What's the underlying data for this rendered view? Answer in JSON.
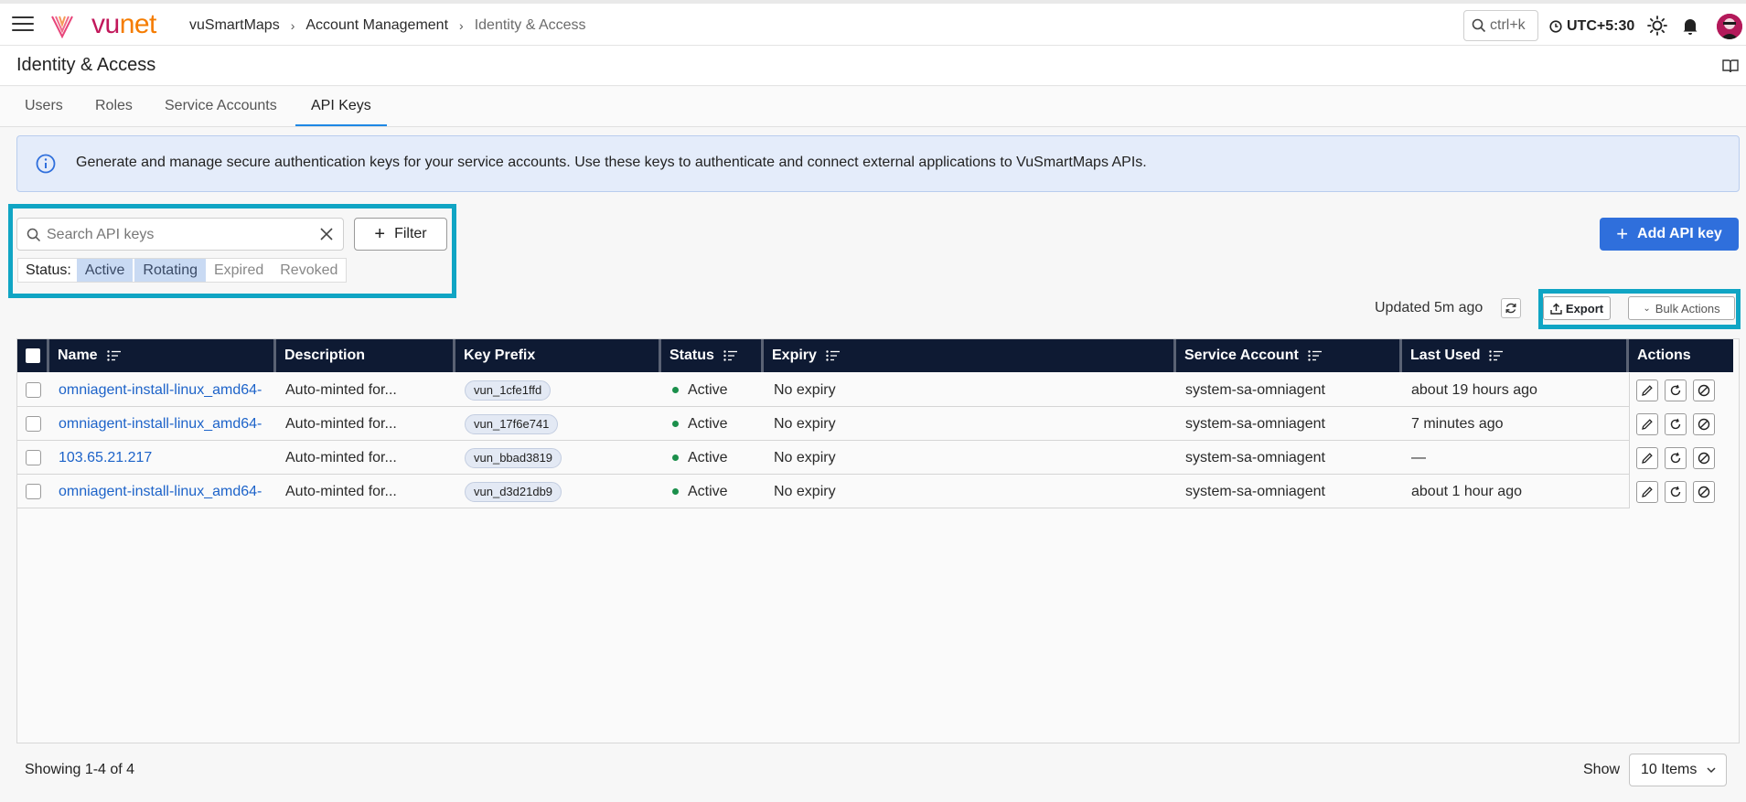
{
  "topbar": {
    "logo": {
      "vu": "vu",
      "net": "net"
    },
    "breadcrumb": [
      "vuSmartMaps",
      "Account Management",
      "Identity & Access"
    ],
    "breadcrumb_separator": "›",
    "search_shortcut": "ctrl+k",
    "timezone": "UTC+5:30"
  },
  "page": {
    "title": "Identity & Access"
  },
  "tabs": [
    {
      "label": "Users",
      "active": false
    },
    {
      "label": "Roles",
      "active": false
    },
    {
      "label": "Service Accounts",
      "active": false
    },
    {
      "label": "API Keys",
      "active": true
    }
  ],
  "banner": {
    "text": "Generate and manage secure authentication keys for your service accounts. Use these keys to authenticate and connect external applications to VuSmartMaps APIs."
  },
  "search": {
    "placeholder": "Search API keys"
  },
  "filter": {
    "label": "Filter"
  },
  "status_filter": {
    "label": "Status:",
    "options": [
      {
        "label": "Active",
        "selected": true
      },
      {
        "label": "Rotating",
        "selected": true
      },
      {
        "label": "Expired",
        "selected": false
      },
      {
        "label": "Revoked",
        "selected": false
      }
    ]
  },
  "toolbar": {
    "add_label": "Add API key",
    "updated": "Updated 5m ago",
    "export_label": "Export",
    "bulk_label": "Bulk Actions"
  },
  "table": {
    "headers": [
      "Name",
      "Description",
      "Key Prefix",
      "Status",
      "Expiry",
      "Service Account",
      "Last Used",
      "Actions"
    ],
    "rows": [
      {
        "name": "omniagent-install-linux_amd64-",
        "description": "Auto-minted for...",
        "prefix": "vun_1cfe1ffd",
        "status": "Active",
        "expiry": "No expiry",
        "service_account": "system-sa-omniagent",
        "last_used": "about 19 hours ago"
      },
      {
        "name": "omniagent-install-linux_amd64-",
        "description": "Auto-minted for...",
        "prefix": "vun_17f6e741",
        "status": "Active",
        "expiry": "No expiry",
        "service_account": "system-sa-omniagent",
        "last_used": "7 minutes ago"
      },
      {
        "name": "103.65.21.217",
        "description": "Auto-minted for...",
        "prefix": "vun_bbad3819",
        "status": "Active",
        "expiry": "No expiry",
        "service_account": "system-sa-omniagent",
        "last_used": "—"
      },
      {
        "name": "omniagent-install-linux_amd64-",
        "description": "Auto-minted for...",
        "prefix": "vun_d3d21db9",
        "status": "Active",
        "expiry": "No expiry",
        "service_account": "system-sa-omniagent",
        "last_used": "about 1 hour ago"
      }
    ]
  },
  "footer": {
    "showing": "Showing 1-4 of 4",
    "show_label": "Show",
    "page_size": "10 Items"
  },
  "colors": {
    "accent": "#2f6fdc",
    "header_bg": "#0e1a33",
    "highlight_border": "#10a5c4",
    "status_active": "#1b8f4b"
  }
}
